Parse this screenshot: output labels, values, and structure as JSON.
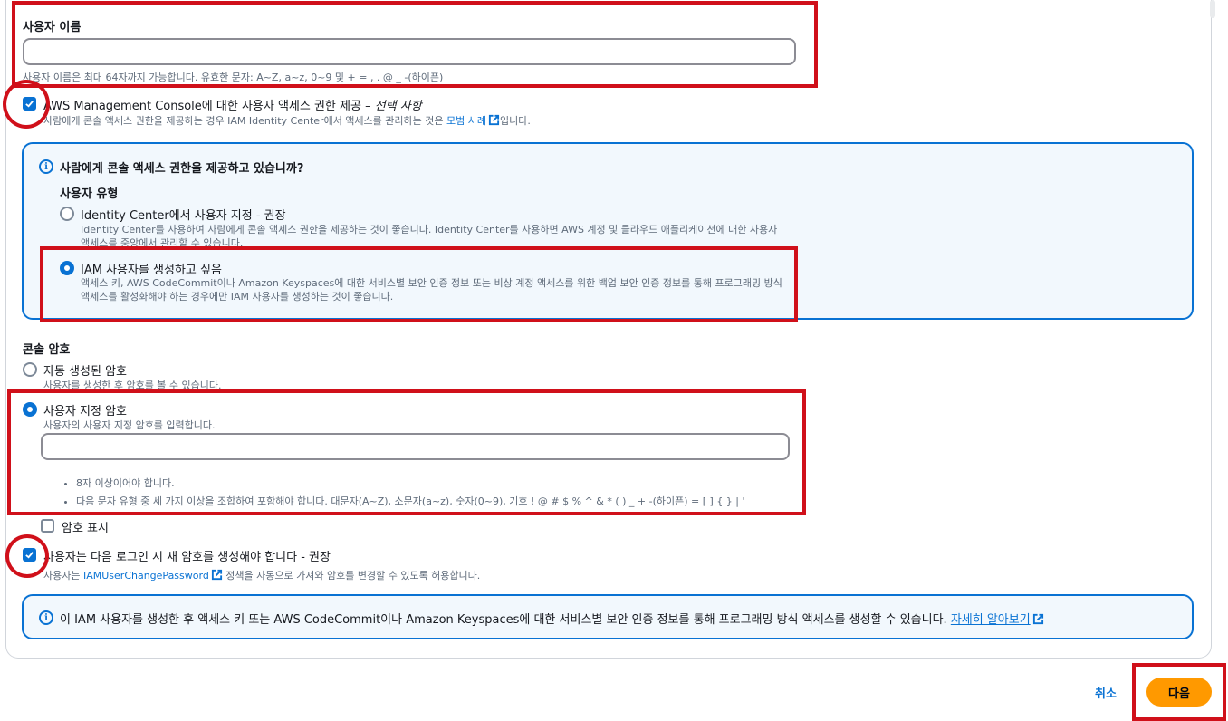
{
  "username": {
    "label": "사용자 이름",
    "value": "",
    "hint": "사용자 이름은 최대 64자까지 가능합니다. 유효한 문자: A~Z, a~z, 0~9 및 + = , . @ _ -(하이픈)"
  },
  "console_access": {
    "checked": true,
    "label": "AWS Management Console에 대한 사용자 액세스 권한 제공 – ",
    "optional": "선택 사항",
    "desc_before": "사람에게 콘솔 액세스 권한을 제공하는 경우 IAM Identity Center에서 액세스를 관리하는 것은 ",
    "desc_link": "모범 사례",
    "desc_after": "입니다."
  },
  "info_panel": {
    "title": "사람에게 콘솔 액세스 권한을 제공하고 있습니까?",
    "user_type_label": "사용자 유형",
    "options": [
      {
        "label": "Identity Center에서 사용자 지정 - 권장",
        "desc": "Identity Center를 사용하여 사람에게 콘솔 액세스 권한을 제공하는 것이 좋습니다. Identity Center를 사용하면 AWS 계정 및 클라우드 애플리케이션에 대한 사용자 액세스를 중앙에서 관리할 수 있습니다.",
        "selected": false
      },
      {
        "label": "IAM 사용자를 생성하고 싶음",
        "desc": "액세스 키, AWS CodeCommit이나 Amazon Keyspaces에 대한 서비스별 보안 인증 정보 또는 비상 계정 액세스를 위한 백업 보안 인증 정보를 통해 프로그래밍 방식 액세스를 활성화해야 하는 경우에만 IAM 사용자를 생성하는 것이 좋습니다.",
        "selected": true
      }
    ]
  },
  "password": {
    "label": "콘솔 암호",
    "auto": {
      "label": "자동 생성된 암호",
      "desc": "사용자를 생성한 후 암호를 볼 수 있습니다.",
      "selected": false
    },
    "custom": {
      "label": "사용자 지정 암호",
      "desc": "사용자의 사용자 지정 암호를 입력합니다.",
      "selected": true,
      "value": ""
    },
    "requirements": [
      "8자 이상이어야 합니다.",
      "다음 문자 유형 중 세 가지 이상을 조합하여 포함해야 합니다. 대문자(A~Z), 소문자(a~z), 숫자(0~9), 기호 ! @ # $ % ^ & * ( ) _ + -(하이픈) = [ ] { } | '"
    ],
    "show_password": {
      "label": "암호 표시",
      "checked": false
    }
  },
  "require_reset": {
    "checked": true,
    "label": "사용자는 다음 로그인 시 새 암호를 생성해야 합니다 - 권장",
    "desc_before": "사용자는 ",
    "desc_link": "IAMUserChangePassword",
    "desc_after": " 정책을 자동으로 가져와 암호를 변경할 수 있도록 허용합니다."
  },
  "bottom_info": {
    "text": "이 IAM 사용자를 생성한 후 액세스 키 또는 AWS CodeCommit이나 Amazon Keyspaces에 대한 서비스별 보안 인증 정보를 통해 프로그래밍 방식 액세스를 생성할 수 있습니다. ",
    "link": "자세히 알아보기"
  },
  "footer": {
    "cancel": "취소",
    "next": "다음"
  },
  "colors": {
    "accent": "#0972d3",
    "primary_button": "#ff9900",
    "annotation": "#d0101a"
  }
}
